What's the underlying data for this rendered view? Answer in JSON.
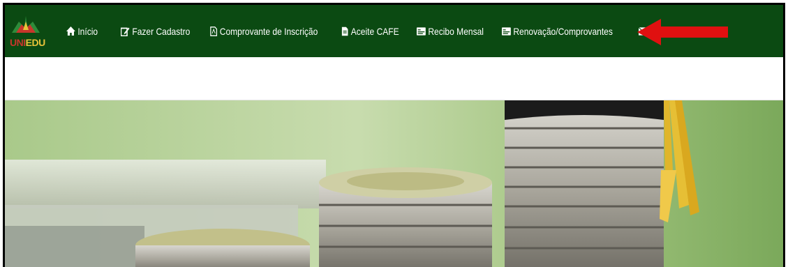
{
  "brand": {
    "logo_uni": "UNI",
    "logo_edu": "EDU"
  },
  "nav": {
    "items": [
      {
        "label": "Início",
        "icon": "home-icon"
      },
      {
        "label": "Fazer Cadastro",
        "icon": "edit-icon"
      },
      {
        "label": "Comprovante de Inscrição",
        "icon": "pdf-file-icon"
      },
      {
        "label": "Aceite CAFE",
        "icon": "file-icon"
      },
      {
        "label": "Recibo Mensal",
        "icon": "receipt-icon"
      },
      {
        "label": "Renovação/Comprovantes",
        "icon": "receipt-icon"
      }
    ],
    "partial_item_icon": "envelope-icon"
  },
  "colors": {
    "navbar_bg": "#0b4a12",
    "arrow": "#e01010",
    "logo_red": "#c7362b",
    "logo_yellow": "#e8c33a"
  },
  "hero": {
    "image": "stacks-of-coins-with-graduation-cap-tassel"
  }
}
